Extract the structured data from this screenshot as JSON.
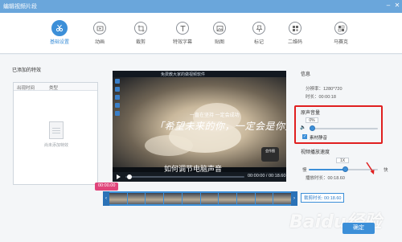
{
  "window": {
    "title": "编辑视频片段"
  },
  "toolbar": {
    "items": [
      {
        "label": "基础设置",
        "active": true
      },
      {
        "label": "动画"
      },
      {
        "label": "裁剪"
      },
      {
        "label": "特效字幕"
      },
      {
        "label": "贴图"
      },
      {
        "label": "标记"
      },
      {
        "label": "二维码"
      },
      {
        "label": "马赛克"
      }
    ]
  },
  "left_panel": {
    "heading": "已添加的特效",
    "columns": [
      "出现时间",
      "类型"
    ],
    "empty_text": "尚未添加特效"
  },
  "video": {
    "topbar_text": "免费教大家的做视频软件",
    "caption_top": "一直在坚持  一定会成功",
    "caption_main": "「希望未来的你，一定会是你」",
    "caption_sub": "如何调节电脑声音",
    "logo_text": "会作图",
    "time": "00:00:00 / 00:18.60"
  },
  "right_panel": {
    "info_heading": "信息",
    "resolution": "分辨率：1280*720",
    "duration": "时长：00:00:18",
    "volume_label": "原声音量",
    "volume_value": "0%",
    "mute_label": "素材静音",
    "speed_label": "视频播放速度",
    "speed_value": "1X",
    "speed_slow": "慢",
    "speed_fast": "快",
    "play_duration": "播放时长：00:18.60",
    "total_duration": "裁剪时长: 00:18.60"
  },
  "timeline": {
    "start_time": "00:00.00"
  },
  "actions": {
    "ok_label": "确定"
  },
  "watermark": "Baidu经验",
  "colors": {
    "accent": "#3c8fd8",
    "highlight": "#e02020",
    "titlebar": "#6aa6db"
  }
}
